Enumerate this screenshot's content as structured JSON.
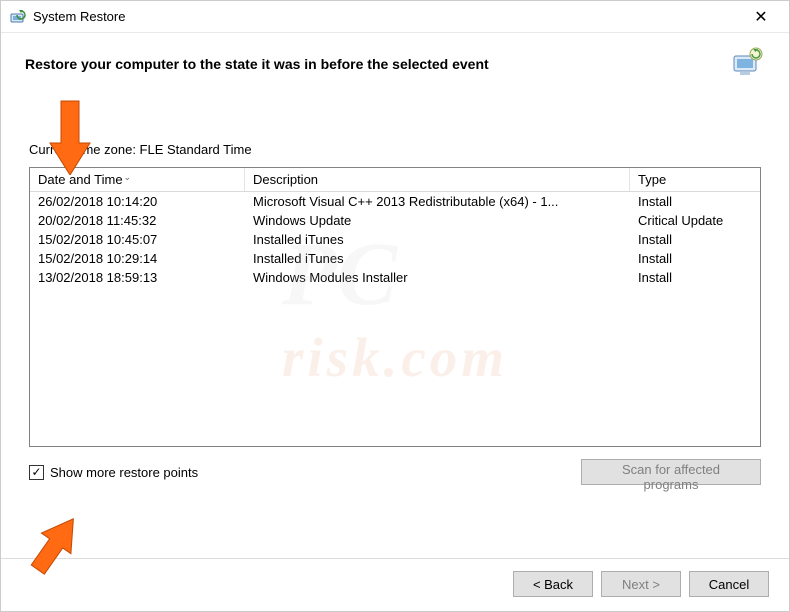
{
  "window": {
    "title": "System Restore",
    "heading": "Restore your computer to the state it was in before the selected event"
  },
  "timezone_line": "Current time zone: FLE Standard Time",
  "columns": {
    "date": "Date and Time",
    "desc": "Description",
    "type": "Type"
  },
  "rows": [
    {
      "date": "26/02/2018 10:14:20",
      "desc": "Microsoft Visual C++ 2013 Redistributable (x64) - 1...",
      "type": "Install"
    },
    {
      "date": "20/02/2018 11:45:32",
      "desc": "Windows Update",
      "type": "Critical Update"
    },
    {
      "date": "15/02/2018 10:45:07",
      "desc": "Installed iTunes",
      "type": "Install"
    },
    {
      "date": "15/02/2018 10:29:14",
      "desc": "Installed iTunes",
      "type": "Install"
    },
    {
      "date": "13/02/2018 18:59:13",
      "desc": "Windows Modules Installer",
      "type": "Install"
    }
  ],
  "checkbox": {
    "label": "Show more restore points",
    "checked": true
  },
  "buttons": {
    "scan": "Scan for affected programs",
    "back": "< Back",
    "next": "Next >",
    "cancel": "Cancel"
  }
}
